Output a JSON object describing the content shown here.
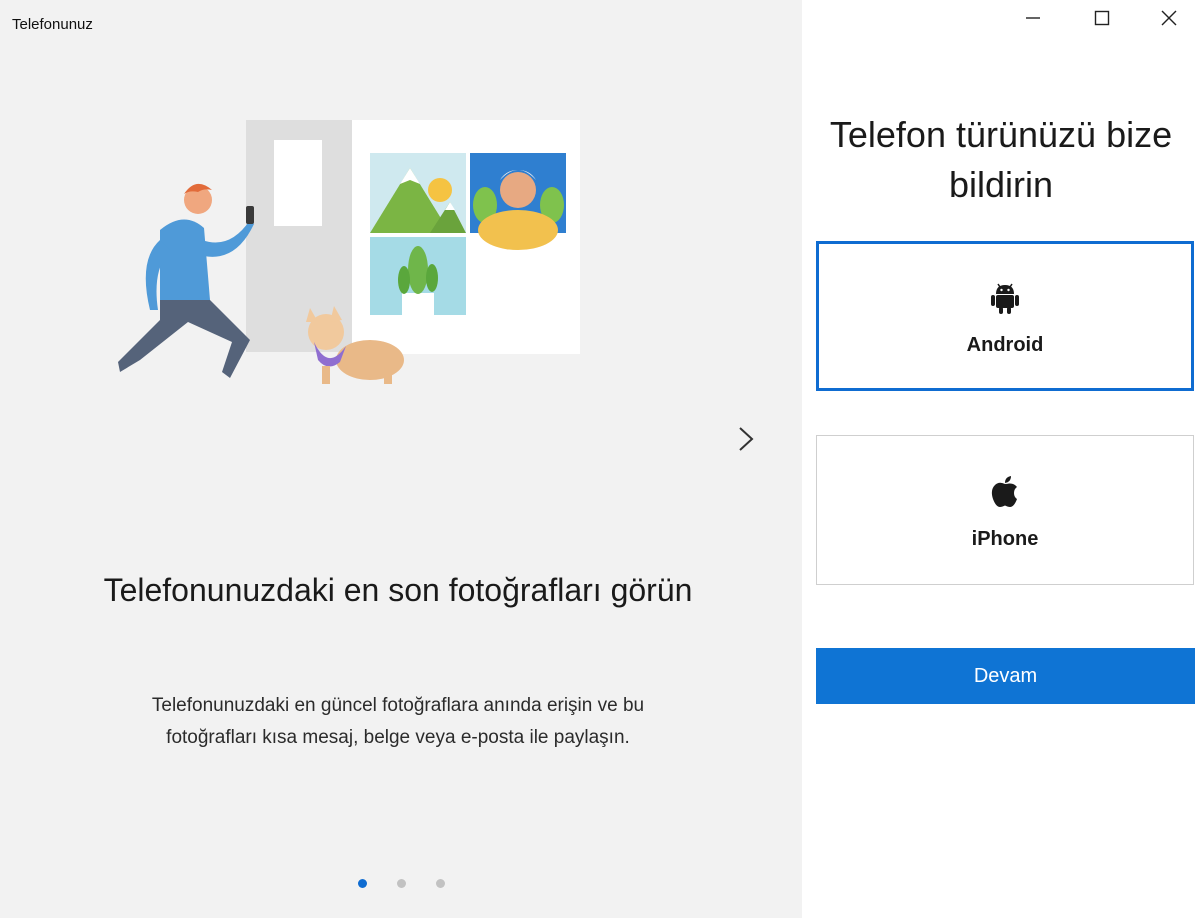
{
  "window": {
    "title": "Telefonunuz",
    "controls": {
      "minimize_icon": "minimize-icon",
      "maximize_icon": "maximize-icon",
      "close_icon": "close-icon"
    }
  },
  "carousel": {
    "slide_title": "Telefonunuzdaki en son fotoğrafları görün",
    "slide_description": "Telefonunuzdaki en güncel fotoğraflara anında erişin ve bu fotoğrafları kısa mesaj, belge veya e-posta ile paylaşın.",
    "next_icon": "chevron-right-icon",
    "pages": 3,
    "active_page": 1
  },
  "setup": {
    "question": "Telefon türünüzü bize bildirin",
    "options": [
      {
        "label": "Android",
        "icon": "android-icon",
        "selected": true
      },
      {
        "label": "iPhone",
        "icon": "apple-icon",
        "selected": false
      }
    ],
    "continue_label": "Devam"
  },
  "colors": {
    "accent": "#0f74d4",
    "left_background": "#f2f2f2",
    "selected_border": "#0f6cd1"
  }
}
